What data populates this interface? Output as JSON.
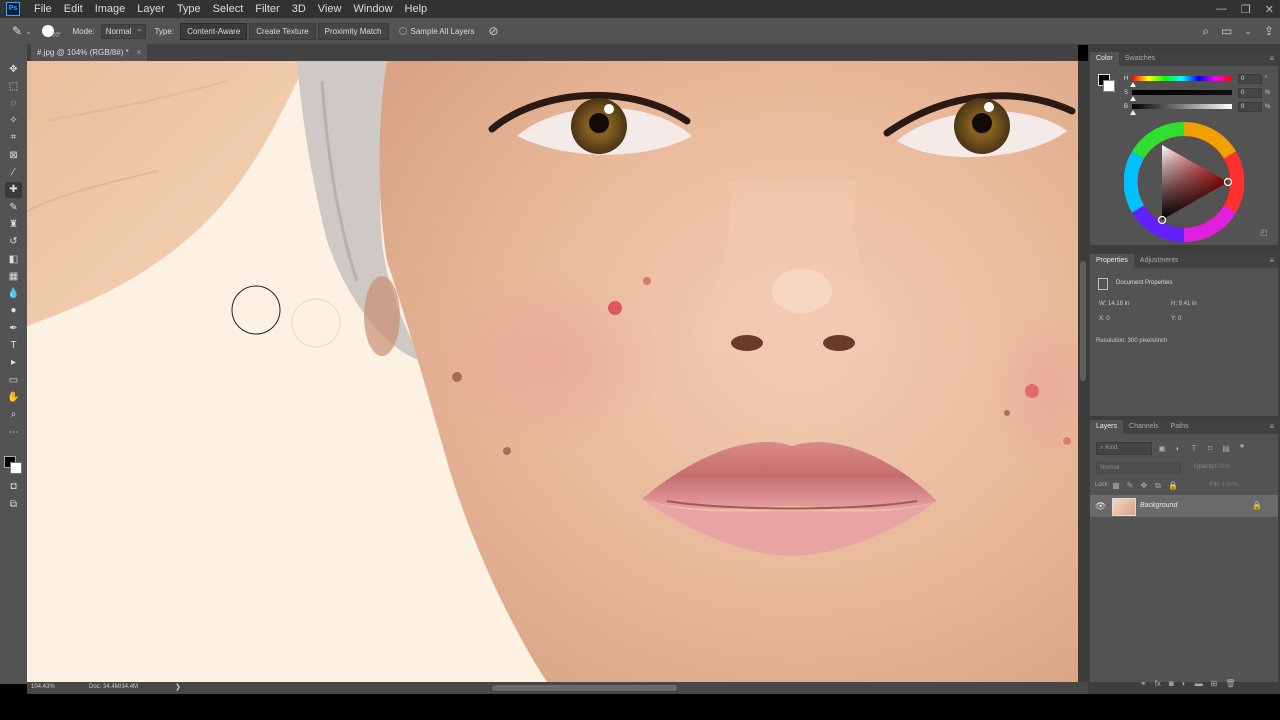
{
  "app": {
    "logo": "Ps"
  },
  "menu": [
    "File",
    "Edit",
    "Image",
    "Layer",
    "Type",
    "Select",
    "Filter",
    "3D",
    "View",
    "Window",
    "Help"
  ],
  "window_controls": {
    "minimize": "—",
    "restore": "❐",
    "close": "✕"
  },
  "options_bar": {
    "brush_size": "70",
    "mode_label": "Mode:",
    "mode_value": "Normal",
    "type_label": "Type:",
    "type_buttons": [
      "Content-Aware",
      "Create Texture",
      "Proximity Match"
    ],
    "active_type": "Content-Aware",
    "sample_all_layers": "Sample All Layers",
    "sample_all_layers_checked": false
  },
  "document": {
    "tab_title": "#.jpg @ 104% (RGB/8#) *",
    "tab_close": "×"
  },
  "status_bar": {
    "zoom": "104.43%",
    "doc_size": "Doc: 34.4M/34.4M",
    "arrow": "❯"
  },
  "color_panel": {
    "tabs": [
      "Color",
      "Swatches"
    ],
    "active_tab": "Color",
    "sliders": [
      {
        "label": "H",
        "value": "0",
        "unit": "°"
      },
      {
        "label": "S",
        "value": "0",
        "unit": "%"
      },
      {
        "label": "B",
        "value": "0",
        "unit": "%"
      }
    ],
    "foreground_color": "#000000",
    "background_color": "#ffffff"
  },
  "properties_panel": {
    "tabs": [
      "Properties",
      "Adjustments"
    ],
    "active_tab": "Properties",
    "section_title": "Document Properties",
    "width": "W:  14.18 in",
    "height": "H:  9.41 in",
    "x": "X:  0",
    "y": "Y:  0",
    "resolution": "Resolution: 300 pixels/inch"
  },
  "layers_panel": {
    "tabs": [
      "Layers",
      "Channels",
      "Paths"
    ],
    "active_tab": "Layers",
    "filter_placeholder": "Kind",
    "blend_mode": "Normal",
    "opacity_label": "Opacity:",
    "opacity_value": "100%",
    "lock_label": "Lock:",
    "fill_label": "Fill:",
    "fill_value": "100%",
    "layers": [
      {
        "name": "Background",
        "visible": true,
        "locked": true
      }
    ]
  },
  "colors": {
    "ui_dark": "#323232",
    "ui_panel": "#535353",
    "accent": "#31a8ff",
    "canvas_bg": "#fdf1e4"
  }
}
